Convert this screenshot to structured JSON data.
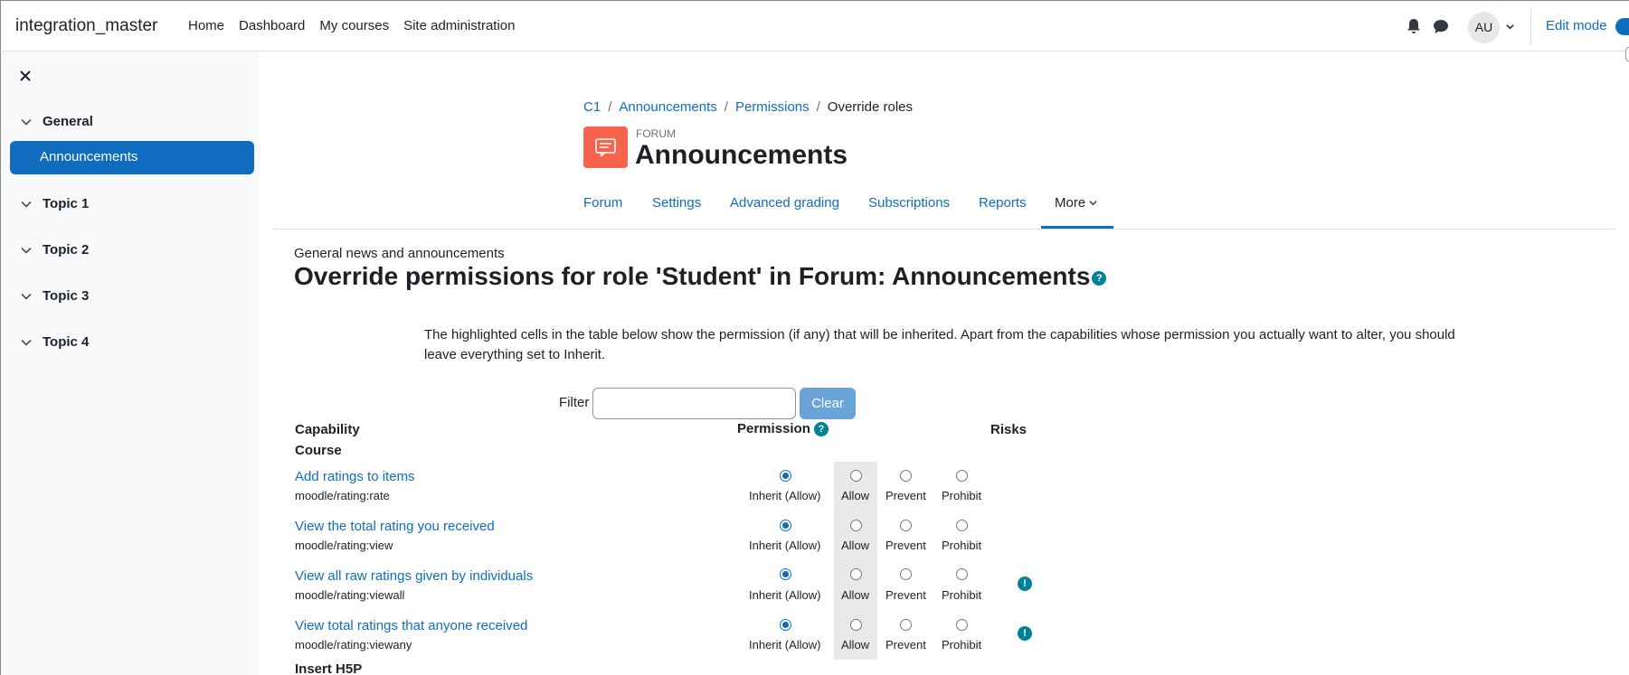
{
  "header": {
    "site_name": "integration_master",
    "nav": [
      "Home",
      "Dashboard",
      "My courses",
      "Site administration"
    ],
    "avatar_initials": "AU",
    "edit_mode_label": "Edit mode"
  },
  "sidebar": {
    "sections": [
      {
        "label": "General",
        "items": [
          "Announcements"
        ]
      },
      {
        "label": "Topic 1"
      },
      {
        "label": "Topic 2"
      },
      {
        "label": "Topic 3"
      },
      {
        "label": "Topic 4"
      }
    ],
    "active_item": "Announcements"
  },
  "breadcrumb": [
    "C1",
    "Announcements",
    "Permissions",
    "Override roles"
  ],
  "activity": {
    "type_label": "FORUM",
    "title": "Announcements"
  },
  "tabs": [
    "Forum",
    "Settings",
    "Advanced grading",
    "Subscriptions",
    "Reports",
    "More"
  ],
  "page": {
    "subtitle": "General news and announcements",
    "heading": "Override permissions for role 'Student' in Forum: Announcements",
    "description": "The highlighted cells in the table below show the permission (if any) that will be inherited. Apart from the capabilities whose permission you actually want to alter, you should leave everything set to Inherit."
  },
  "filter": {
    "label": "Filter",
    "value": "",
    "clear_label": "Clear"
  },
  "table": {
    "headers": {
      "capability": "Capability",
      "permission": "Permission",
      "risks": "Risks"
    },
    "groups": [
      "Course",
      "Insert H5P"
    ],
    "options": [
      "Inherit (Allow)",
      "Allow",
      "Prevent",
      "Prohibit"
    ],
    "rows": [
      {
        "name": "Add ratings to items",
        "code": "moodle/rating:rate",
        "selected": "Inherit (Allow)",
        "risk": false
      },
      {
        "name": "View the total rating you received",
        "code": "moodle/rating:view",
        "selected": "Inherit (Allow)",
        "risk": false
      },
      {
        "name": "View all raw ratings given by individuals",
        "code": "moodle/rating:viewall",
        "selected": "Inherit (Allow)",
        "risk": true
      },
      {
        "name": "View total ratings that anyone received",
        "code": "moodle/rating:viewany",
        "selected": "Inherit (Allow)",
        "risk": true
      }
    ]
  },
  "colors": {
    "brand": "#0f6cbf",
    "forum_icon": "#f7634d",
    "help": "#008196"
  }
}
